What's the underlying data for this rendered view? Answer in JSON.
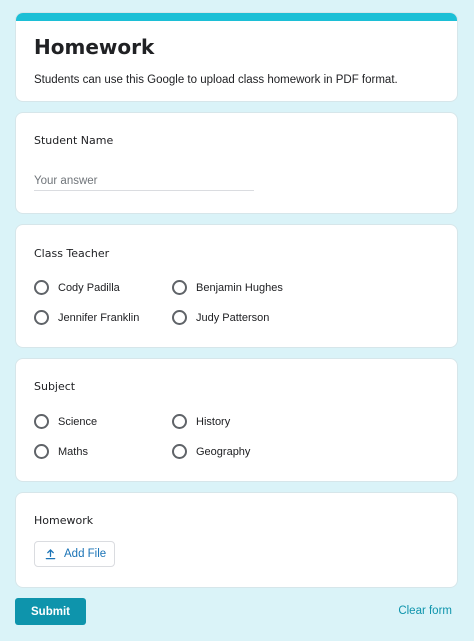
{
  "form": {
    "title": "Homework",
    "description": "Students can use this Google to upload class homework in PDF format."
  },
  "student_name": {
    "label": "Student Name",
    "placeholder": "Your answer",
    "value": ""
  },
  "class_teacher": {
    "label": "Class Teacher",
    "options": [
      "Cody Padilla",
      "Benjamin Hughes",
      "Jennifer Franklin",
      "Judy Patterson"
    ]
  },
  "subject": {
    "label": "Subject",
    "options": [
      "Science",
      "History",
      "Maths",
      "Geography"
    ]
  },
  "homework": {
    "label": "Homework",
    "add_file_label": "Add File",
    "icon": "upload-icon"
  },
  "actions": {
    "submit_label": "Submit",
    "clear_label": "Clear form"
  },
  "colors": {
    "accent": "#1cbfd6",
    "submit": "#0e94ac",
    "background": "#daf3f8"
  }
}
